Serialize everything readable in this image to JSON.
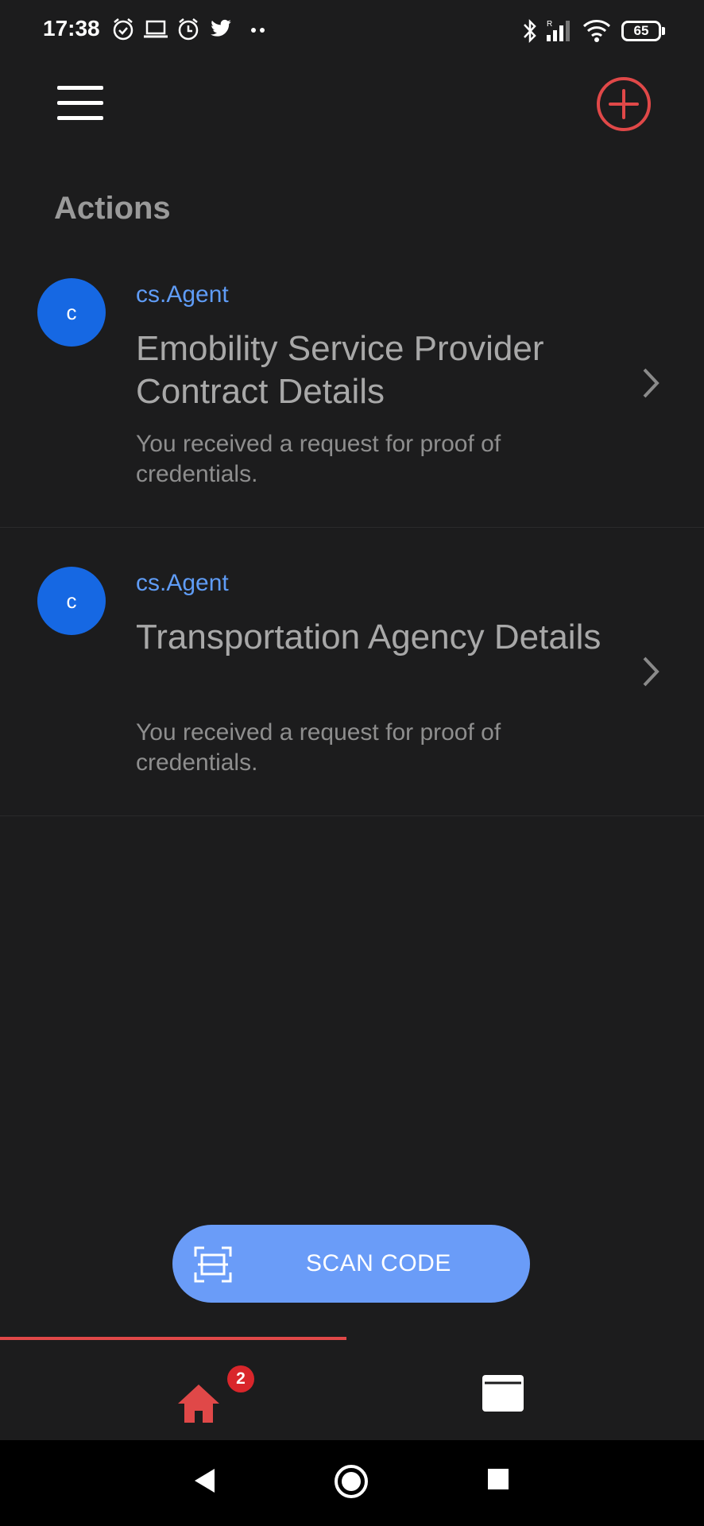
{
  "status_bar": {
    "time": "17:38",
    "battery": "65",
    "icons": [
      "alarm-icon",
      "laptop-icon",
      "alarm-clock-icon",
      "twitter-icon",
      "more-dots-icon",
      "bluetooth-icon",
      "signal-icon",
      "wifi-icon",
      "battery-icon"
    ]
  },
  "header": {
    "menu_icon": "hamburger-menu-icon",
    "add_icon": "add-circle-icon"
  },
  "section_title": "Actions",
  "actions": [
    {
      "avatar_letter": "c",
      "agent": "cs.Agent",
      "title": "Emobility Service Provider Contract Details",
      "description": "You received a request for proof of credentials."
    },
    {
      "avatar_letter": "c",
      "agent": "cs.Agent",
      "title": "Transportation Agency Details",
      "description": "You received a request for proof of credentials."
    }
  ],
  "scan_button": {
    "label": "SCAN CODE",
    "icon": "scan-frame-icon"
  },
  "tab_bar": {
    "home_badge": "2",
    "tabs": [
      "home-icon",
      "wallet-icon"
    ]
  },
  "colors": {
    "background": "#1c1c1d",
    "accent_red": "#e04848",
    "agent_blue": "#5f9cf6",
    "avatar_blue": "#1668e3",
    "scan_button": "#6a9cf8",
    "badge_red": "#d9262b"
  }
}
